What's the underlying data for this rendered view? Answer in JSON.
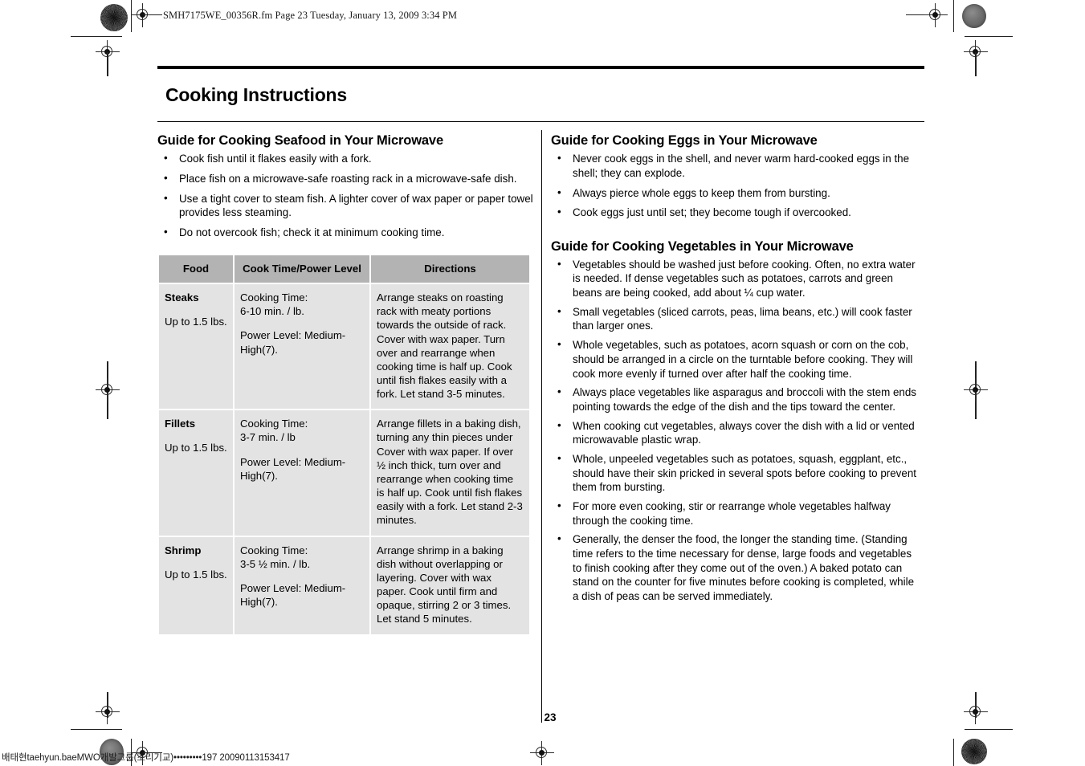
{
  "file_header": "SMH7175WE_00356R.fm  Page 23  Tuesday, January 13, 2009  3:34 PM",
  "page_title": "Cooking Instructions",
  "page_number": "23",
  "footer_code": "배태현taehyun.baeMWO개발그룹(조리기교)•••••••••197 20090113153417",
  "left_column": {
    "seafood": {
      "heading": "Guide for Cooking Seafood in Your Microwave",
      "bullets": [
        "Cook fish until it flakes easily with a fork.",
        "Place fish on a microwave-safe roasting rack in a microwave-safe dish.",
        "Use a tight cover to steam fish. A lighter cover of wax paper or paper towel provides less steaming.",
        "Do not overcook fish; check it at minimum cooking time."
      ]
    },
    "table": {
      "headers": [
        "Food",
        "Cook Time/Power Level",
        "Directions"
      ],
      "rows": [
        {
          "food_name": "Steaks",
          "food_qty": "Up to 1.5 lbs.",
          "cook_time": "Cooking Time:\n6-10 min. / lb.",
          "power_level": "Power Level: Medium-High(7).",
          "directions": "Arrange steaks on roasting rack with meaty portions towards the outside of rack. Cover with wax paper. Turn over and rearrange when cooking time is half up. Cook until fish flakes easily with a fork. Let stand 3-5 minutes."
        },
        {
          "food_name": "Fillets",
          "food_qty": "Up to 1.5 lbs.",
          "cook_time": "Cooking Time:\n3-7 min. / lb",
          "power_level": "Power Level: Medium-High(7).",
          "directions": "Arrange fillets in a baking dish, turning any thin pieces under Cover with wax paper. If over ½ inch thick, turn over and rearrange when cooking time is half up. Cook until fish flakes easily with a fork. Let stand 2-3 minutes."
        },
        {
          "food_name": "Shrimp",
          "food_qty": "Up to 1.5 lbs.",
          "cook_time": "Cooking Time:\n3-5 ½ min. / lb.",
          "power_level": "Power Level: Medium-High(7).",
          "directions": "Arrange shrimp in a baking dish without overlapping or layering. Cover with wax paper. Cook until firm and opaque, stirring 2 or 3 times. Let stand 5 minutes."
        }
      ]
    }
  },
  "right_column": {
    "eggs": {
      "heading": "Guide for Cooking Eggs in Your Microwave",
      "bullets": [
        "Never cook eggs in the shell, and never warm hard-cooked eggs in the shell; they can explode.",
        "Always pierce whole eggs to keep them from bursting.",
        "Cook eggs just until set; they become tough if overcooked."
      ]
    },
    "vegetables": {
      "heading": "Guide for Cooking Vegetables in Your Microwave",
      "bullets": [
        "Vegetables should be washed just before cooking. Often, no extra water is needed. If dense vegetables such as potatoes, carrots and green beans are being cooked, add about ¼ cup water.",
        "Small vegetables (sliced carrots, peas, lima beans, etc.) will cook faster than larger ones.",
        "Whole vegetables, such as potatoes, acorn squash or corn on the cob, should be arranged in a circle on the turntable before cooking. They will cook more evenly if turned over after half the cooking time.",
        "Always place vegetables like asparagus and broccoli with the stem ends pointing towards the edge of the dish and the tips toward the center.",
        "When cooking cut vegetables, always cover the dish with a lid or vented microwavable plastic wrap.",
        "Whole, unpeeled vegetables such as potatoes, squash, eggplant, etc., should have their skin pricked in several spots before cooking to prevent them from bursting.",
        "For more even cooking, stir or rearrange whole vegetables halfway through the cooking time.",
        "Generally, the denser the food, the longer the standing time. (Standing time refers to the time necessary for dense, large foods and vegetables to finish cooking after they come out of the oven.) A baked potato can stand on the counter for five minutes before cooking is completed, while a dish of peas can be served immediately."
      ]
    }
  },
  "colors": {
    "table_header_bg": "#b3b3b3",
    "table_cell_bg": "#e3e3e3",
    "rule": "#000000"
  }
}
